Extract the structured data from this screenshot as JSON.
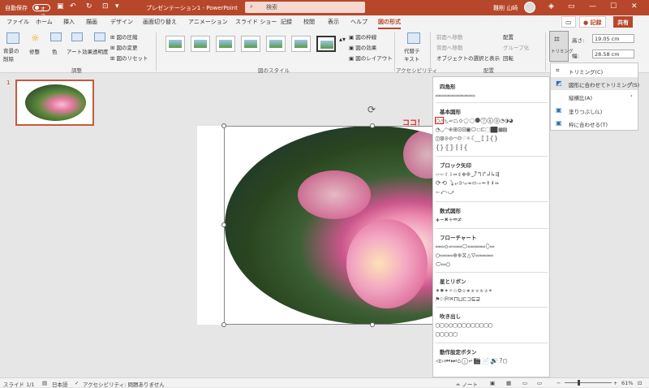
{
  "titlebar": {
    "autosave": "自動保存",
    "toggle": "オフ",
    "title": "プレゼンテーション1  -  PowerPoint",
    "search": "検索",
    "user": "難削 山崎"
  },
  "tabs": [
    "ファイル",
    "ホーム",
    "挿入",
    "描画",
    "デザイン",
    "画面切り替え",
    "アニメーション",
    "スライド ショー",
    "記録",
    "校閲",
    "表示",
    "ヘルプ",
    "図の形式"
  ],
  "tab_buttons": {
    "record": "● 記録",
    "share": "共有"
  },
  "ribbon": {
    "remove_bg": "背景の\n削除",
    "correct": "修整",
    "color": "色",
    "art": "アート効果",
    "transparency": "透明度",
    "compress": "図の圧縮",
    "change": "図の変更",
    "reset": "図のリセット",
    "adjust_label": "調整",
    "style_label": "図のスタイル",
    "border": "図の枠線",
    "effects": "図の効果",
    "layout": "図のレイアウト",
    "alt_text": "代替テ\nキスト",
    "access_label": "アクセシビリティ",
    "forward": "前面へ移動",
    "backward": "背面へ移動",
    "selection_pane": "オブジェクトの選択と表示",
    "align": "配置",
    "group": "グループ化",
    "rotate": "回転",
    "arrange_label": "配置",
    "crop": "トリミング",
    "height_label": "高さ:",
    "height": "19.05 cm",
    "width_label": "幅:",
    "width": "28.58 cm"
  },
  "slide_number": "1",
  "koko": "ココ！",
  "shape_panel": {
    "sections": [
      {
        "title": "四角形",
        "rows": [
          "▭▭▭▭▭▭▭▭▭"
        ]
      },
      {
        "title": "基本図形",
        "rows": [
          "◯△◺▱⏢◇⬠⬡⯃⑦⑧⑨◔◑◕",
          "◔◡◠⊕⊞⊡⊟▣⬭☐⊏⬚⬛▦▧",
          "◫⊠⊙⊘⌒☺♡☼☾⁐⟦⟧{}",
          "{}⦃⦄⁅⁆{"
        ]
      },
      {
        "title": "ブロック矢印",
        "rows": [
          "⇨⇦⇧⇩⇔⇕✥⊕⤴↰↱↲↳⇶",
          "⟳⟲⤵⤶➲⤷⇥⬄⇨⬅⬆⬇↔",
          "⇦⤺⤻"
        ]
      },
      {
        "title": "数式図形",
        "rows": [
          "✚−✖÷═≠"
        ]
      },
      {
        "title": "フローチャート",
        "rows": [
          "▭▭◇▱▭▭⬭▭▭▭▭⬯▭",
          "◯▭▭▭⊗⊕⧖△▽▭▭▭▭",
          "⬭▭◯"
        ]
      },
      {
        "title": "星とリボン",
        "rows": [
          "✷✸✦✧✩✪✫✬✭✮✯✰✴",
          "⚑⚐⛿⌘⊓⊔⊏⊐⊑⊒"
        ]
      },
      {
        "title": "吹き出し",
        "rows": [
          "▢▢◯◯▢▢▢▢▢▢▢▢▢",
          "▢▢▢▢▢"
        ]
      },
      {
        "title": "動作設定ボタン",
        "rows": [
          "◁▷⏮⏭⌂ⓘ↩🎬📄🔊?▢"
        ]
      }
    ]
  },
  "trim_menu": [
    {
      "label": "トリミング(C)",
      "icon": "crop-icon"
    },
    {
      "label": "図形に合わせてトリミング(S)",
      "icon": "shape-crop-icon",
      "submenu": true
    },
    {
      "label": "縦横比(A)",
      "submenu": true
    },
    {
      "label": "塗りつぶし(L)",
      "icon": "fill-icon"
    },
    {
      "label": "枠に合わせる(T)",
      "icon": "fit-icon"
    }
  ],
  "status": {
    "slide": "スライド 1/1",
    "lang": "日本語",
    "access": "アクセシビリティ: 問題ありません",
    "notes": "ノート",
    "zoom": "61%"
  },
  "colors": {
    "accent": "#b7472a",
    "highlight": "#e02020"
  }
}
